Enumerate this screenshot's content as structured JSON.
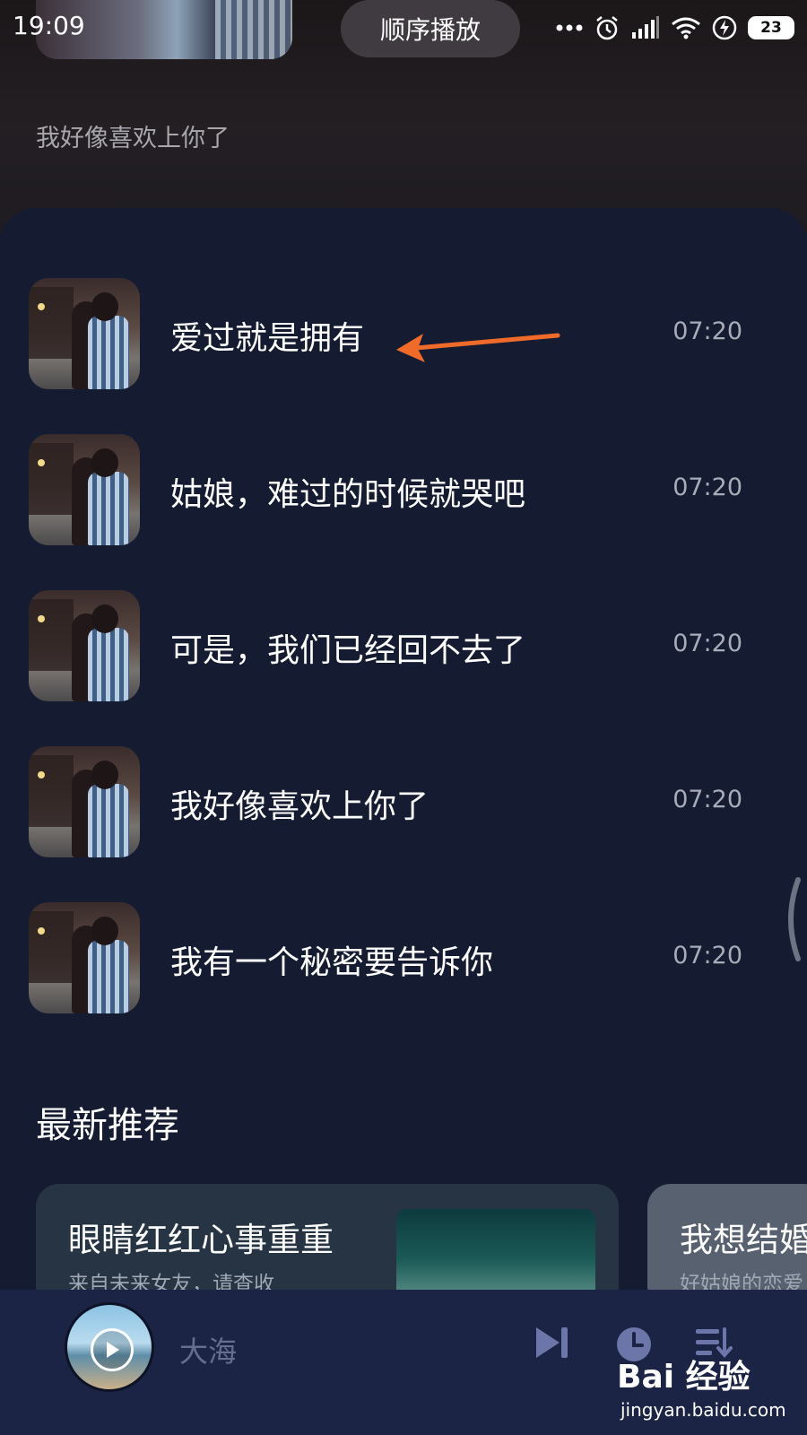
{
  "status_bar": {
    "time": "19:09",
    "battery_level": "23"
  },
  "header": {
    "play_mode": "顺序播放",
    "current_lyric": "我好像喜欢上你了"
  },
  "songs": [
    {
      "title": "爱过就是拥有",
      "duration": "07:20"
    },
    {
      "title": "姑娘，难过的时候就哭吧",
      "duration": "07:20"
    },
    {
      "title": "可是，我们已经回不去了",
      "duration": "07:20"
    },
    {
      "title": "我好像喜欢上你了",
      "duration": "07:20"
    },
    {
      "title": "我有一个秘密要告诉你",
      "duration": "07:20"
    }
  ],
  "recommend": {
    "section_title": "最新推荐",
    "cards": [
      {
        "title": "眼睛红红心事重重",
        "subtitle": "来自未来女友，请查收"
      },
      {
        "title": "我想结婚",
        "subtitle": "好姑娘的恋爱"
      }
    ]
  },
  "player": {
    "title": "大海"
  },
  "watermark": {
    "logo_text": "Bai 经验",
    "url": "jingyan.baidu.com"
  },
  "colors": {
    "panel_bg": "#151c31",
    "player_bg": "#1c2445",
    "arrow": "#f06a2a"
  }
}
